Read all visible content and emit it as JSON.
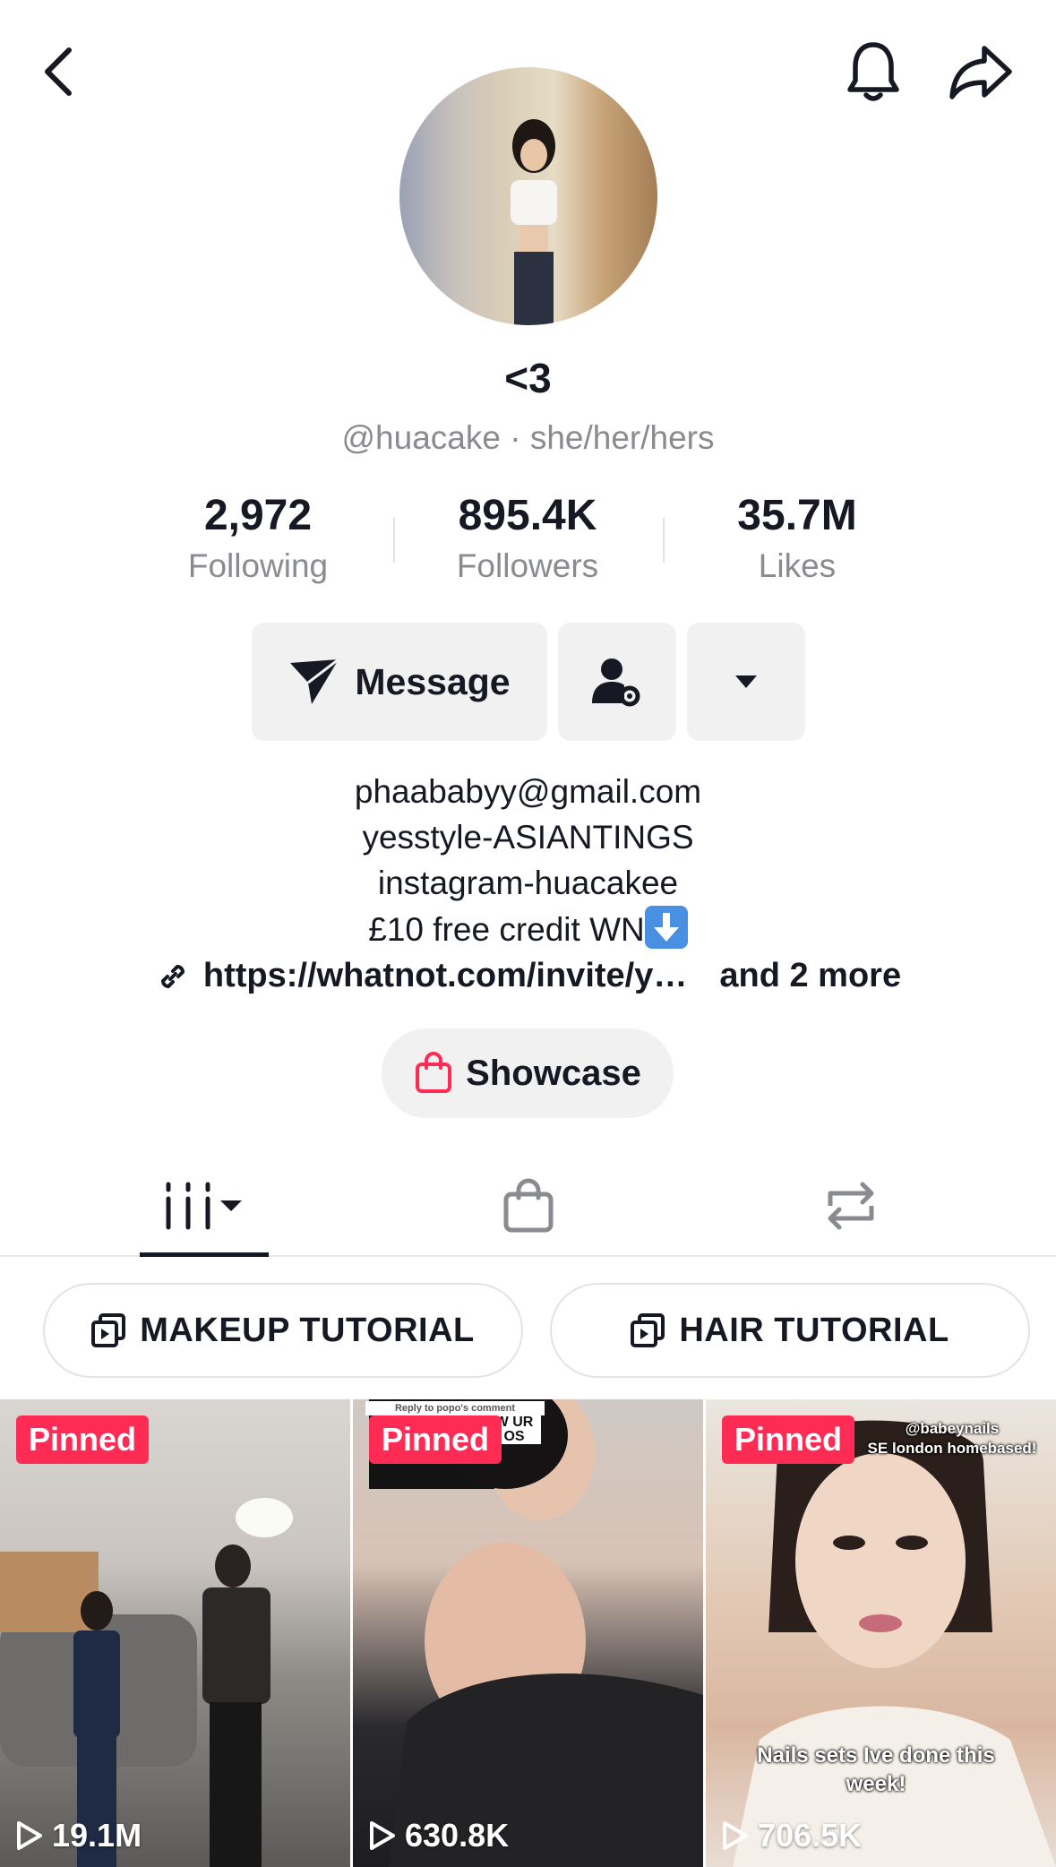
{
  "profile": {
    "display_name": "<3",
    "handle_line": "@huacake · she/her/hers"
  },
  "stats": {
    "following": {
      "value": "2,972",
      "label": "Following"
    },
    "followers": {
      "value": "895.4K",
      "label": "Followers"
    },
    "likes": {
      "value": "35.7M",
      "label": "Likes"
    }
  },
  "actions": {
    "message_label": "Message"
  },
  "bio": {
    "line1": "phaababyy@gmail.com",
    "line2": "yesstyle-ASIANTINGS",
    "line3": "instagram-huacakee",
    "line4": "£10 free credit WN",
    "link": "https://whatnot.com/invite/y…",
    "link_more": "and 2 more"
  },
  "showcase": {
    "label": "Showcase"
  },
  "playlists": [
    {
      "label": "MAKEUP TUTORIAL"
    },
    {
      "label": "HAIR TUTORIAL"
    }
  ],
  "videos": [
    {
      "badge": "Pinned",
      "views": "19.1M"
    },
    {
      "badge": "Pinned",
      "views": "630.8K",
      "caption_top_small": "Reply to popo's comment",
      "caption_top_large": "W UR\nOS"
    },
    {
      "badge": "Pinned",
      "views": "706.5K",
      "caption_top": "@babeynails\nSE london homebased!",
      "caption_bottom": "Nails sets Ive done this\nweek!"
    }
  ],
  "colors": {
    "accent": "#fe2c55",
    "text_primary": "#161823",
    "text_secondary": "#8a8b91",
    "button_bg": "#f1f1f2"
  }
}
